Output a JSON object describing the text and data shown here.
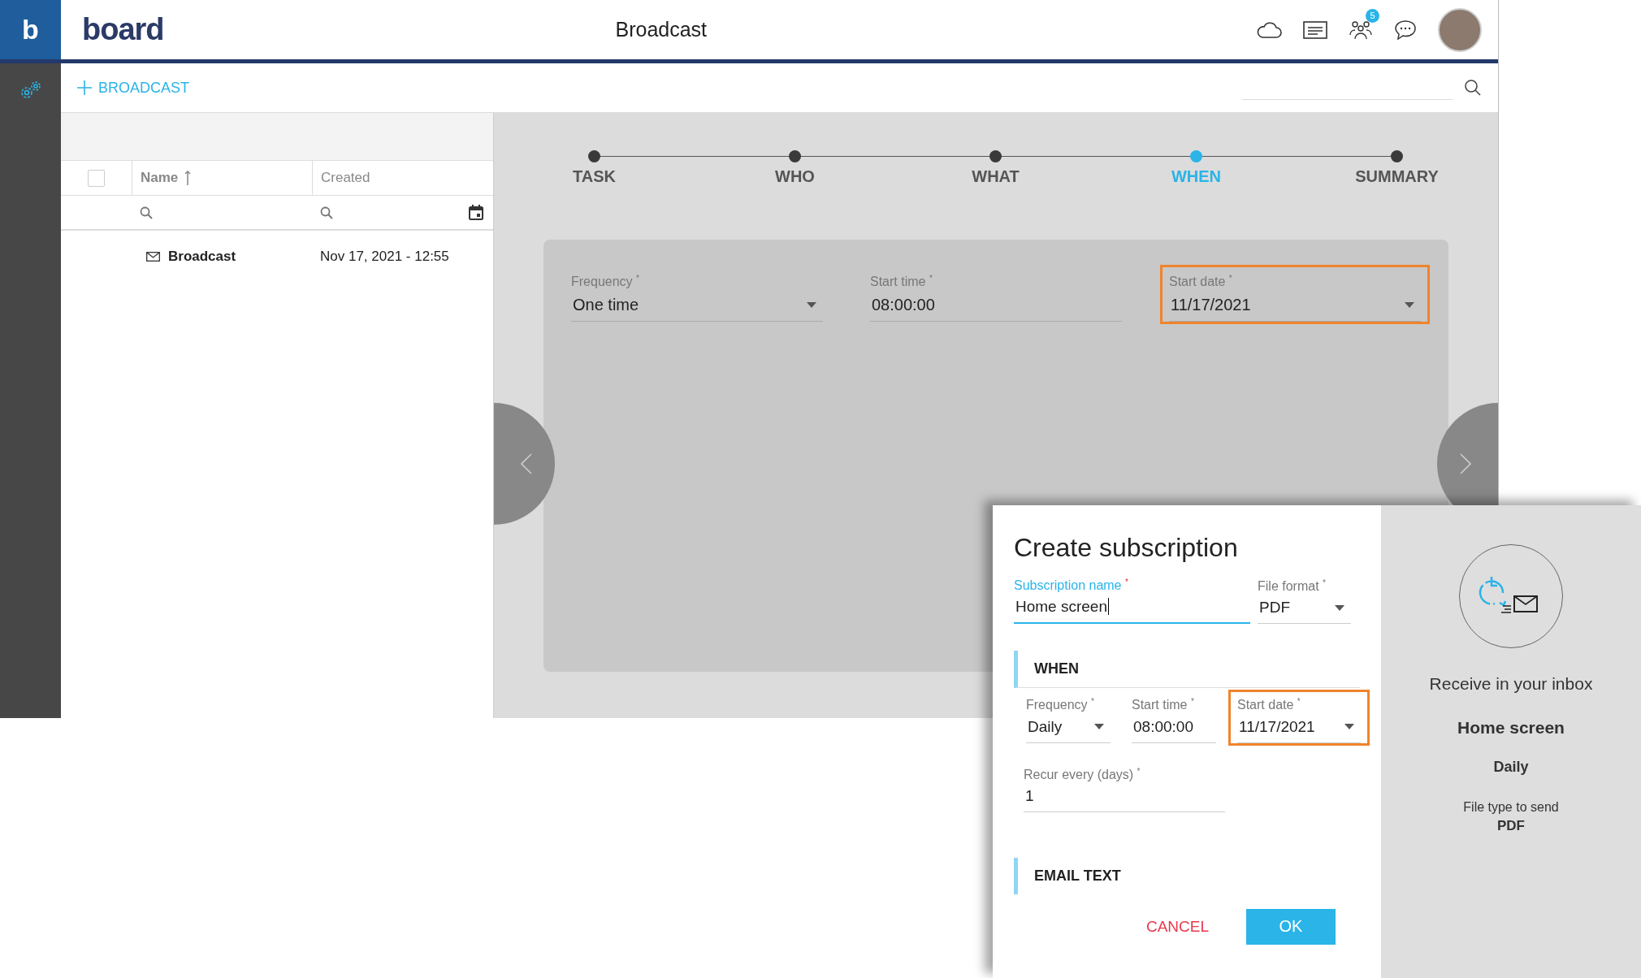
{
  "brand": {
    "mark": "b",
    "wordmark": "board"
  },
  "header": {
    "title": "Broadcast",
    "notification_count": "5"
  },
  "toolbar": {
    "add_label": "BROADCAST"
  },
  "table": {
    "select_all_checked": false,
    "columns": [
      {
        "label": "Name",
        "sorted": true
      },
      {
        "label": "Created",
        "sorted": false
      }
    ],
    "rows": [
      {
        "name": "Broadcast",
        "created": "Nov 17, 2021 - 12:55"
      }
    ]
  },
  "stepper": {
    "steps": [
      {
        "label": "TASK",
        "selected": false
      },
      {
        "label": "WHO",
        "selected": false
      },
      {
        "label": "WHAT",
        "selected": false
      },
      {
        "label": "WHEN",
        "selected": true
      },
      {
        "label": "SUMMARY",
        "selected": false
      }
    ]
  },
  "when_form": {
    "fields": [
      {
        "label": "Frequency $^{*}$",
        "value": "One time",
        "kind": "dropdown",
        "highlighted": false
      },
      {
        "label": "Start time $^{*}$",
        "value": "08:00:00",
        "kind": "text",
        "highlighted": false
      },
      {
        "label": "Start date $^{*}$",
        "value": "11/17/2021",
        "kind": "dropdown",
        "highlighted": true
      }
    ]
  },
  "dialog": {
    "title": "Create subscription",
    "name_field": {
      "label": "Subscription name $^{*}$",
      "value": "Home screen",
      "focused": true
    },
    "format_field": {
      "label": "File format $^{*}$",
      "value": "PDF",
      "kind": "dropdown"
    },
    "when_heading": "WHEN",
    "when_fields": [
      {
        "label": "Frequency $^{*}$",
        "value": "Daily",
        "kind": "dropdown",
        "highlighted": false
      },
      {
        "label": "Start time $^{*}$",
        "value": "08:00:00",
        "kind": "text",
        "highlighted": false
      },
      {
        "label": "Start date $^{*}$",
        "value": "11/17/2021",
        "kind": "dropdown",
        "highlighted": true
      }
    ],
    "recur_field": {
      "label": "Recur every (days) $^{*}$",
      "value": "1"
    },
    "email_heading": "EMAIL TEXT",
    "buttons": [
      {
        "label": "CANCEL",
        "kind": "text"
      },
      {
        "label": "OK",
        "kind": "primary"
      }
    ]
  },
  "summary": {
    "caption": "Receive in your inbox",
    "name": "Home screen",
    "frequency": "Daily",
    "file_type_label": "File type to send",
    "file_type": "PDF"
  }
}
